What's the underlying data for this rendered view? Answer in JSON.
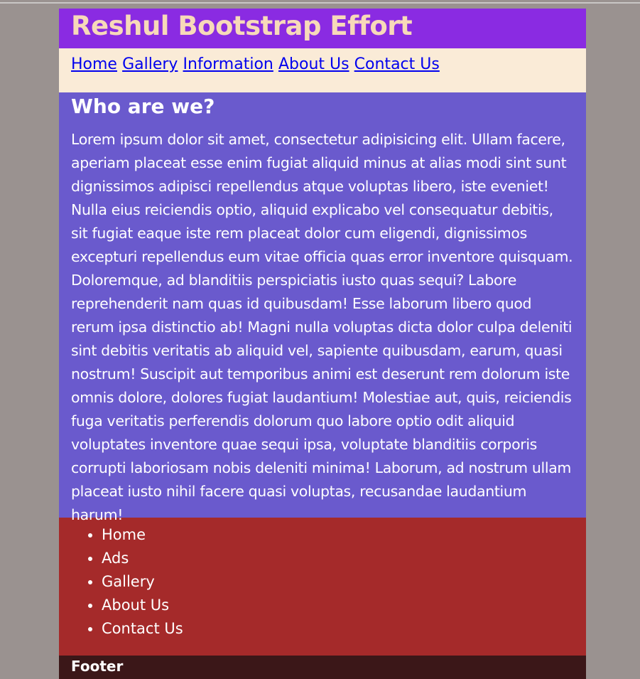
{
  "header": {
    "title": "Reshul Bootstrap Effort"
  },
  "top_nav": {
    "links": [
      {
        "label": "Home"
      },
      {
        "label": "Gallery"
      },
      {
        "label": "Information"
      },
      {
        "label": "About Us"
      },
      {
        "label": "Contact Us"
      }
    ]
  },
  "main": {
    "heading": "Who are we?",
    "paragraph": "Lorem ipsum dolor sit amet, consectetur adipisicing elit. Ullam facere, aperiam placeat esse enim fugiat aliquid minus at alias modi sint sunt dignissimos adipisci repellendus atque voluptas libero, iste eveniet! Nulla eius reiciendis optio, aliquid explicabo vel consequatur debitis, sit fugiat eaque iste rem placeat dolor cum eligendi, dignissimos excepturi repellendus eum vitae officia quas error inventore quisquam. Doloremque, ad blanditiis perspiciatis iusto quas sequi? Labore reprehenderit nam quas id quibusdam! Esse laborum libero quod rerum ipsa distinctio ab! Magni nulla voluptas dicta dolor culpa deleniti sint debitis veritatis ab aliquid vel, sapiente quibusdam, earum, quasi nostrum! Suscipit aut temporibus animi est deserunt rem dolorum iste omnis dolore, dolores fugiat laudantium! Molestiae aut, quis, reiciendis fuga veritatis perferendis dolorum quo labore optio odit aliquid voluptates inventore quae sequi ipsa, voluptate blanditiis corporis corrupti laboriosam nobis deleniti minima! Laborum, ad nostrum ullam placeat iusto nihil facere quasi voluptas, recusandae laudantium harum!"
  },
  "side_nav": {
    "items": [
      {
        "label": "Home"
      },
      {
        "label": "Ads"
      },
      {
        "label": "Gallery"
      },
      {
        "label": "About Us"
      },
      {
        "label": "Contact Us"
      }
    ]
  },
  "footer": {
    "text": "Footer"
  },
  "colors": {
    "page_background": "#9a9290",
    "header_background": "#8a2be2",
    "header_text": "#f7d9b9",
    "nav_background": "#faebd7",
    "link": "#0000ee",
    "main_background": "#6a5acd",
    "list_background": "#a52a2a",
    "footer_background": "#3b1718"
  }
}
